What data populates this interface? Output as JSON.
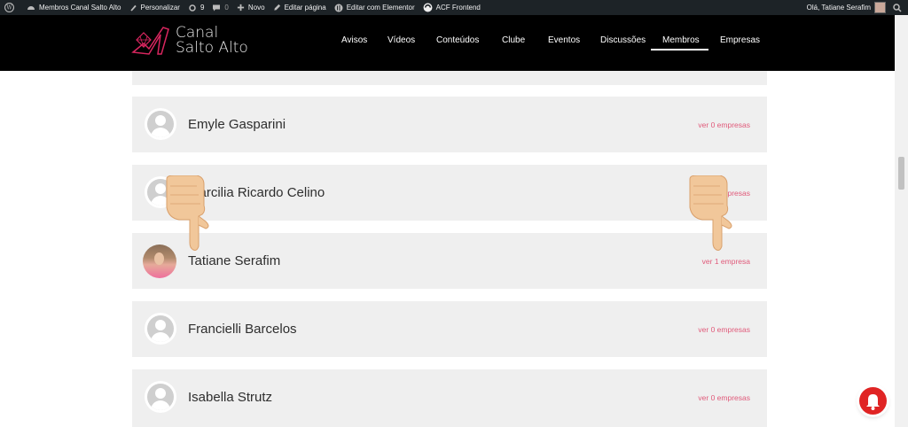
{
  "adminbar": {
    "site_name": "Membros Canal Salto Alto",
    "customize": "Personalizar",
    "updates_count": "9",
    "comments_count": "0",
    "new": "Novo",
    "edit_page": "Editar página",
    "edit_elementor": "Editar com Elementor",
    "acf_frontend": "ACF Frontend",
    "greeting": "Olá, Tatiane Serafim"
  },
  "header": {
    "logo_line1": "Canal",
    "logo_line2": "Salto Alto",
    "nav": [
      "Avisos",
      "Vídeos",
      "Conteúdos",
      "Clube",
      "Eventos",
      "Discussões",
      "Membros",
      "Empresas"
    ],
    "active_nav": "Membros"
  },
  "members": [
    {
      "name": "Emyle Gasparini",
      "link": "ver 0 empresas",
      "photo": false
    },
    {
      "name": "Marcilia Ricardo Celino",
      "link": "ver 0 empresas",
      "photo": false
    },
    {
      "name": "Tatiane Serafim",
      "link": "ver 1 empresa",
      "photo": true
    },
    {
      "name": "Francielli Barcelos",
      "link": "ver 0 empresas",
      "photo": false
    },
    {
      "name": "Isabella Strutz",
      "link": "ver 0 empresas",
      "photo": false
    }
  ],
  "colors": {
    "accent": "#e05a7a",
    "header_bg": "#000000",
    "card_bg": "#efefef",
    "notification": "#e02424"
  },
  "icons": [
    "wordpress-icon",
    "dashboard-icon",
    "brush-icon",
    "updates-icon",
    "comment-icon",
    "plus-icon",
    "pencil-icon",
    "elementor-icon",
    "acf-icon",
    "search-icon",
    "pointing-hand-icon",
    "bell-icon"
  ]
}
